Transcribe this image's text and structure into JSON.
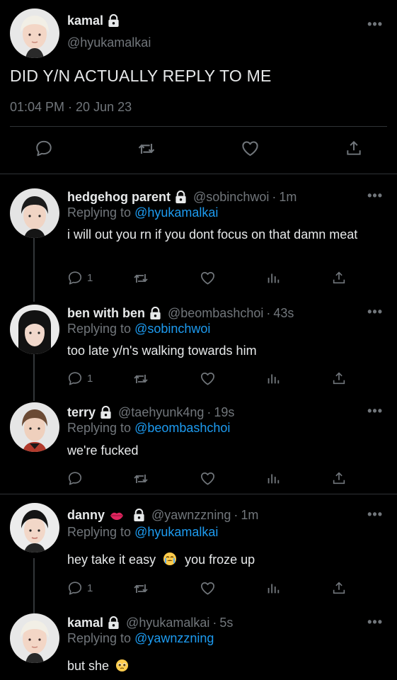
{
  "main": {
    "name": "kamal",
    "handle": "@hyukamalkai",
    "text": "DID Y/N ACTUALLY REPLY TO ME",
    "timestamp": "01:04 PM · 20 Jun 23",
    "more": "•••"
  },
  "replies": [
    {
      "name": "hedgehog parent",
      "handle": "@sobinchwoi",
      "time": "1m",
      "replying_prefix": "Replying to",
      "replying_to": "@hyukamalkai",
      "text": "i will out you rn if you dont focus on that damn meat",
      "reply_count": "1",
      "more": "•••"
    },
    {
      "name": "ben with ben",
      "handle": "@beombashchoi",
      "time": "43s",
      "replying_prefix": "Replying to",
      "replying_to": "@sobinchwoi",
      "text": "too late y/n's walking towards him",
      "reply_count": "1",
      "more": "•••"
    },
    {
      "name": "terry",
      "handle": "@taehyunk4ng",
      "time": "19s",
      "replying_prefix": "Replying to",
      "replying_to": "@beombashchoi",
      "text": "we're fucked",
      "reply_count": "",
      "more": "•••"
    },
    {
      "name": "danny",
      "handle": "@yawnzzning",
      "time": "1m",
      "replying_prefix": "Replying to",
      "replying_to": "@hyukamalkai",
      "text_before": "hey take it easy",
      "text_after": "you froze up",
      "reply_count": "1",
      "more": "•••"
    },
    {
      "name": "kamal",
      "handle": "@hyukamalkai",
      "time": "5s",
      "replying_prefix": "Replying to",
      "replying_to": "@yawnzzning",
      "text": "but she",
      "reply_count": "",
      "more": "•••"
    }
  ],
  "colors": {
    "background": "#000000",
    "text": "#e7e9ea",
    "muted": "#71767b",
    "link": "#1d9bf0",
    "divider": "#2f3336"
  },
  "icons": [
    "lock-icon",
    "more-icon",
    "reply-icon",
    "retweet-icon",
    "like-icon",
    "views-icon",
    "share-icon",
    "lips-emoji",
    "crying-emoji",
    "pleading-emoji"
  ]
}
